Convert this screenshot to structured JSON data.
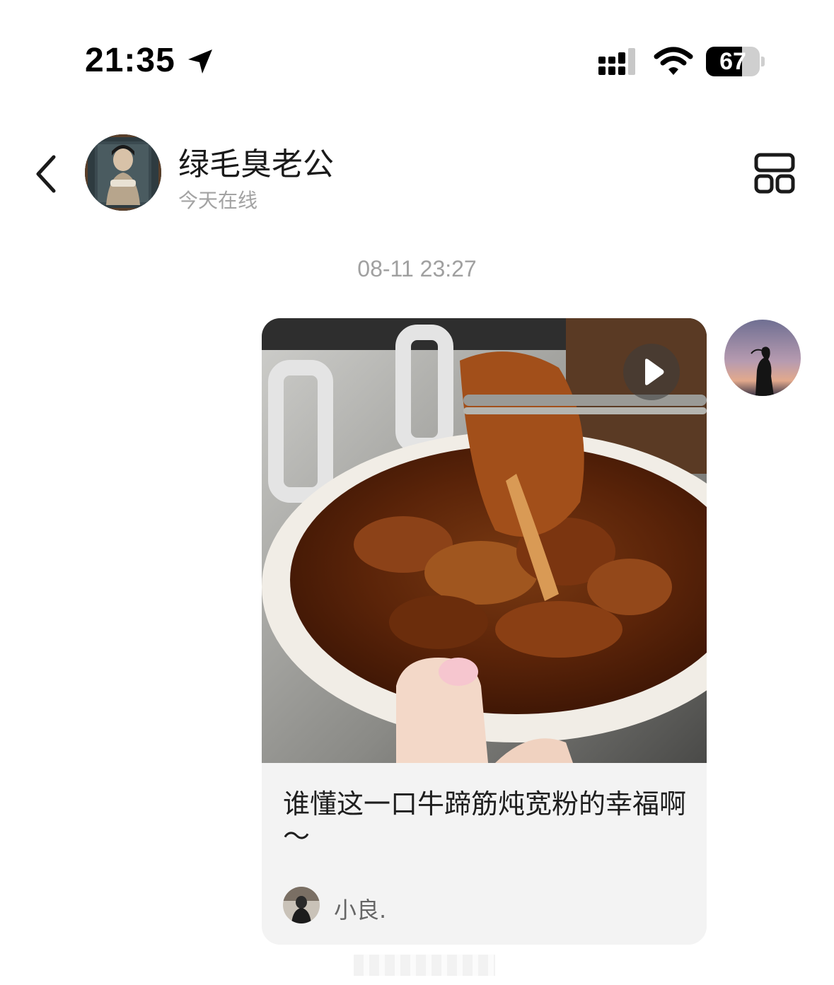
{
  "status_bar": {
    "time": "21:35",
    "battery": "67",
    "battery_level": 0.67,
    "icons": [
      "location-arrow-icon",
      "cellular-signal-icon",
      "wifi-icon",
      "battery-icon"
    ]
  },
  "header": {
    "contact_name": "绿毛臭老公",
    "contact_status": "今天在线",
    "icons": [
      "back-chevron-icon",
      "layout-grid-icon"
    ]
  },
  "conversation": {
    "timestamp": "08-11 23:27",
    "shared_post": {
      "title": "谁懂这一口牛蹄筋炖宽粉的幸福啊～",
      "author": "小良.",
      "media": "video",
      "icons": [
        "play-icon"
      ]
    }
  }
}
